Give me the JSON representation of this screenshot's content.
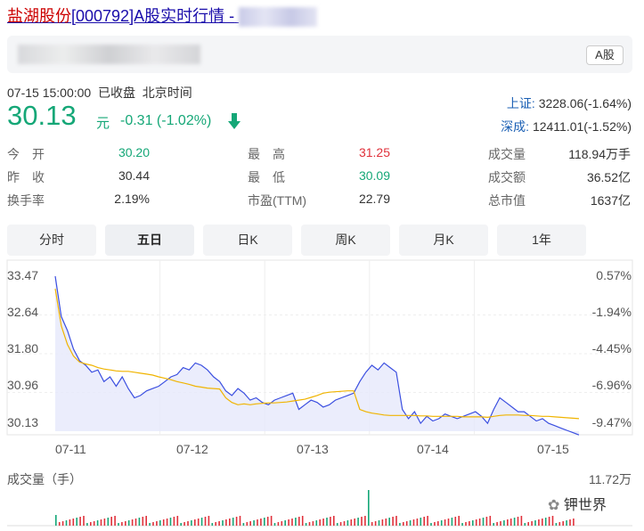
{
  "title": {
    "main": "盐湖股份",
    "rest": "[000792]A股实时行情 -"
  },
  "badge": "A股",
  "status": {
    "time": "07-15 15:00:00",
    "state": "已收盘",
    "tz": "北京时间"
  },
  "quote": {
    "price": "30.13",
    "unit": "元",
    "change": "-0.31 (-1.02%)"
  },
  "indices": [
    {
      "name": "上证:",
      "value": "3228.06(-1.64%)"
    },
    {
      "name": "深成:",
      "value": "12411.01(-1.52%)"
    }
  ],
  "stats": {
    "open_label": "今　开",
    "open": "30.20",
    "prev_label": "昨　收",
    "prev": "30.44",
    "turn_label": "换手率",
    "turn": "2.19%",
    "high_label": "最　高",
    "high": "31.25",
    "low_label": "最　低",
    "low": "30.09",
    "pe_label": "市盈(TTM)",
    "pe": "22.79",
    "vol_label": "成交量",
    "vol": "118.94万手",
    "amt_label": "成交额",
    "amt": "36.52亿",
    "cap_label": "总市值",
    "cap": "1637亿"
  },
  "tabs": [
    "分时",
    "五日",
    "日K",
    "周K",
    "月K",
    "1年"
  ],
  "active_tab": "五日",
  "colors": {
    "down": "#15a777",
    "up": "#e0313b",
    "price_line": "#3b4fe0",
    "avg_line": "#f0b400"
  },
  "chart_data": {
    "type": "line",
    "y_left_ticks": [
      "33.47",
      "32.64",
      "31.80",
      "30.96",
      "30.13"
    ],
    "y_right_ticks": [
      "0.57%",
      "-1.94%",
      "-4.45%",
      "-6.96%",
      "-9.47%"
    ],
    "ylim": [
      30.13,
      33.47
    ],
    "x_ticks": [
      "07-11",
      "07-12",
      "07-13",
      "07-14",
      "07-15"
    ],
    "volume_label": "成交量（手）",
    "volume_max": "11.72万",
    "series": [
      {
        "values": [
          33.47,
          32.6,
          32.3,
          31.9,
          31.65,
          31.55,
          31.4,
          31.45,
          31.2,
          31.3,
          31.1,
          31.3,
          31.05,
          30.85,
          30.9,
          31.0,
          31.05,
          31.1,
          31.2,
          31.3,
          31.35,
          31.5,
          31.45,
          31.6,
          31.55,
          31.45,
          31.3,
          31.2,
          31.0,
          30.9,
          31.05,
          30.95,
          30.8,
          30.85,
          30.75,
          30.7,
          30.8,
          30.85,
          30.9,
          30.95,
          30.6,
          30.7,
          30.8,
          30.75,
          30.65,
          30.7,
          30.8,
          30.85,
          30.9,
          30.95,
          31.2,
          31.4,
          31.55,
          31.45,
          31.6,
          31.5,
          31.4,
          30.6,
          30.4,
          30.55,
          30.3,
          30.45,
          30.35,
          30.4,
          30.5,
          30.45,
          30.4,
          30.45,
          30.5,
          30.55,
          30.45,
          30.3,
          30.6,
          30.85,
          30.75,
          30.65,
          30.55,
          30.55,
          30.45,
          30.35,
          30.4,
          30.3,
          30.25,
          30.2,
          30.15,
          30.1,
          30.05
        ]
      },
      {
        "values": [
          33.2,
          32.4,
          32.0,
          31.75,
          31.62,
          31.58,
          31.55,
          31.5,
          31.47,
          31.45,
          31.43,
          31.42,
          31.42,
          31.4,
          31.38,
          31.36,
          31.34,
          31.3,
          31.27,
          31.24,
          31.2,
          31.17,
          31.14,
          31.1,
          31.08,
          31.06,
          31.05,
          31.04,
          30.85,
          30.75,
          30.7,
          30.72,
          30.7,
          30.72,
          30.73,
          30.74,
          30.74,
          30.75,
          30.76,
          30.78,
          30.8,
          30.82,
          30.86,
          30.9,
          30.95,
          30.97,
          30.98,
          30.99,
          31.0,
          31.0,
          30.6,
          30.55,
          30.52,
          30.5,
          30.48,
          30.47,
          30.47,
          30.47,
          30.47,
          30.47,
          30.46,
          30.46,
          30.45,
          30.45,
          30.45,
          30.45,
          30.45,
          30.44,
          30.44,
          30.44,
          30.44,
          30.43,
          30.45,
          30.47,
          30.48,
          30.48,
          30.48,
          30.47,
          30.47,
          30.46,
          30.45,
          30.45,
          30.44,
          30.43,
          30.42,
          30.41,
          30.4
        ]
      }
    ]
  },
  "watermark": "钾世界"
}
